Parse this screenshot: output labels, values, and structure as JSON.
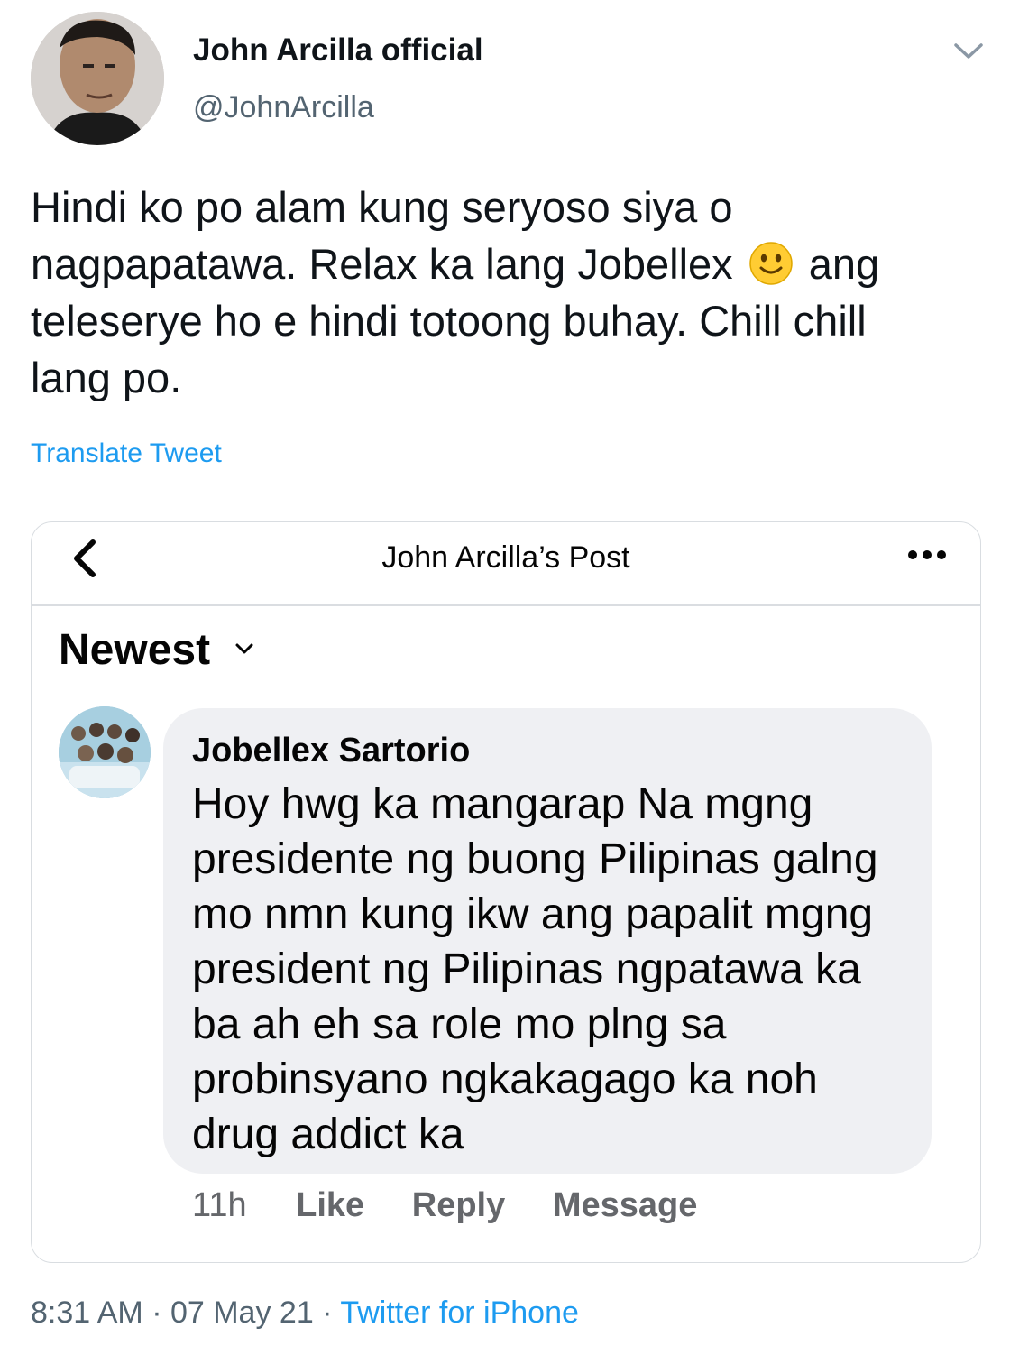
{
  "tweet": {
    "display_name": "John Arcilla official",
    "handle": "@JohnArcilla",
    "text_before_emoji": "Hindi ko po alam kung seryoso siya o nagpapatawa. Relax ka lang Jobellex",
    "emoji": "slightly-smiling-face",
    "text_after_emoji": "ang teleserye ho e hindi totoong buhay. Chill chill lang po.",
    "translate_label": "Translate Tweet",
    "time": "8:31 AM",
    "separator": " · ",
    "date": "07 May 21",
    "source": "Twitter for iPhone"
  },
  "embedded_post": {
    "header_title": "John Arcilla’s Post",
    "sort_label": "Newest",
    "comment": {
      "author": "Jobellex Sartorio",
      "text": "Hoy hwg ka mangarap Na mgng presidente ng buong Pilipinas galng mo nmn kung ikw ang papalit mgng president ng Pilipinas ngpatawa ka ba ah eh sa role mo plng sa probinsyano ngkakagago ka noh drug addict ka",
      "age": "11h",
      "actions": [
        "Like",
        "Reply",
        "Message"
      ]
    }
  },
  "colors": {
    "link": "#1d9bf0",
    "secondary_text": "#536471",
    "bubble": "#eff0f3",
    "fb_secondary": "#65676b"
  }
}
